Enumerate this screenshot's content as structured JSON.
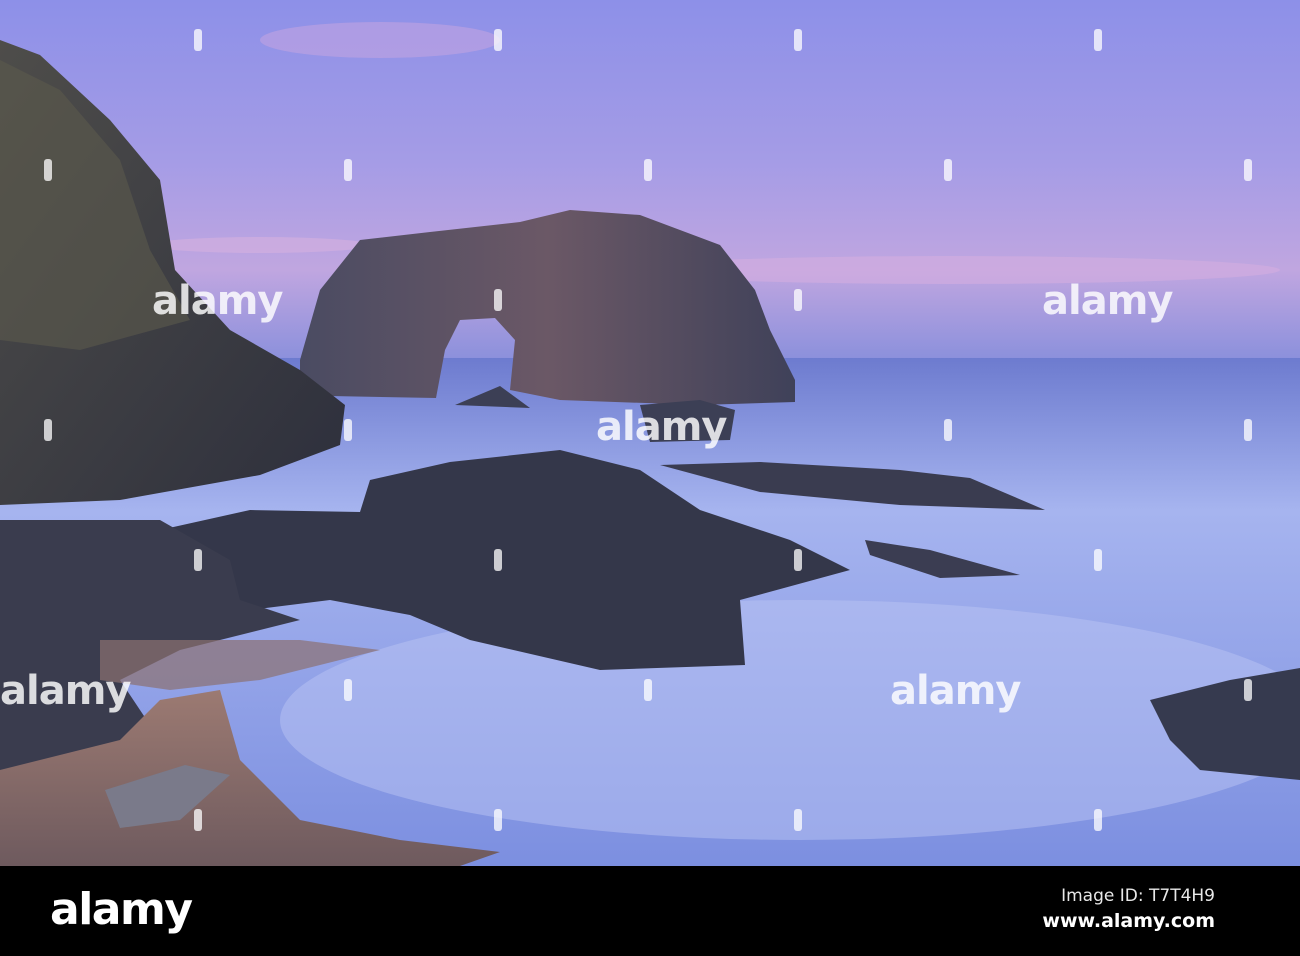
{
  "photo": {
    "subject": "sea-arch-seascape",
    "colors": {
      "sky_top": "#8f8fe6",
      "sky_horizon": "#c5a7df",
      "sea": "#8fa3ea",
      "rock": "#3a3a48",
      "sand": "#8a6e63"
    }
  },
  "watermark": {
    "text": "alamy"
  },
  "footer": {
    "logo": "alamy",
    "image_id": "Image ID: T7T4H9",
    "url": "www.alamy.com"
  }
}
